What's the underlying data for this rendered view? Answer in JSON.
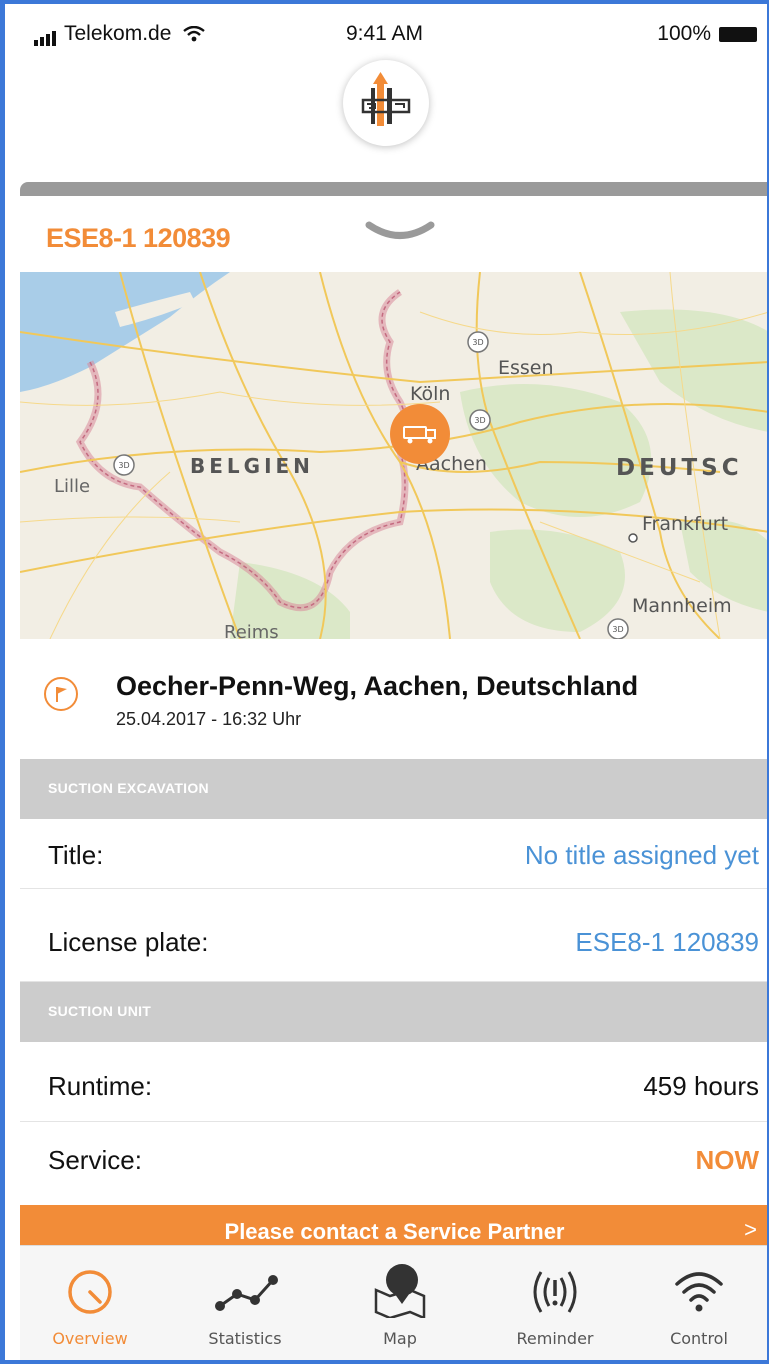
{
  "status_bar": {
    "carrier": "Telekom.de",
    "time": "9:41 AM",
    "battery": "100%"
  },
  "header": {
    "logo_icon": "gsg-logo-icon",
    "vehicle_id": "ESE8-1 120839"
  },
  "map": {
    "labels": {
      "essen": "Essen",
      "koeln": "Köln",
      "belgien": "BELGIEN",
      "lille": "Lille",
      "aachen": "Aachen",
      "deutschland": "DEUTSC",
      "frankfurt": "Frankfurt",
      "mannheim": "Mannheim",
      "reims": "Reims",
      "badge_3d": "3D"
    },
    "pin_icon": "truck-icon"
  },
  "location": {
    "address": "Oecher-Penn-Weg, Aachen, Deutschland",
    "timestamp": "25.04.2017 - 16:32 Uhr"
  },
  "sections": {
    "suction_excavation": "SUCTION EXCAVATION",
    "suction_unit": "SUCTION UNIT"
  },
  "rows": {
    "title_label": "Title:",
    "title_value": "No title assigned yet",
    "plate_label": "License plate:",
    "plate_value": "ESE8-1 120839",
    "runtime_label": "Runtime:",
    "runtime_value": "459 hours",
    "service_label": "Service:",
    "service_value": "NOW"
  },
  "cta": {
    "text": "Please contact a Service Partner",
    "arrow": ">"
  },
  "tabs": [
    {
      "label": "Overview",
      "icon": "gauge-icon"
    },
    {
      "label": "Statistics",
      "icon": "statistics-icon"
    },
    {
      "label": "Map",
      "icon": "map-icon"
    },
    {
      "label": "Reminder",
      "icon": "reminder-icon"
    },
    {
      "label": "Control",
      "icon": "wifi-icon"
    }
  ],
  "colors": {
    "accent": "#f28c38",
    "link": "#4a92d6",
    "section_bg": "#cccccc",
    "frame": "#3c78d8"
  }
}
